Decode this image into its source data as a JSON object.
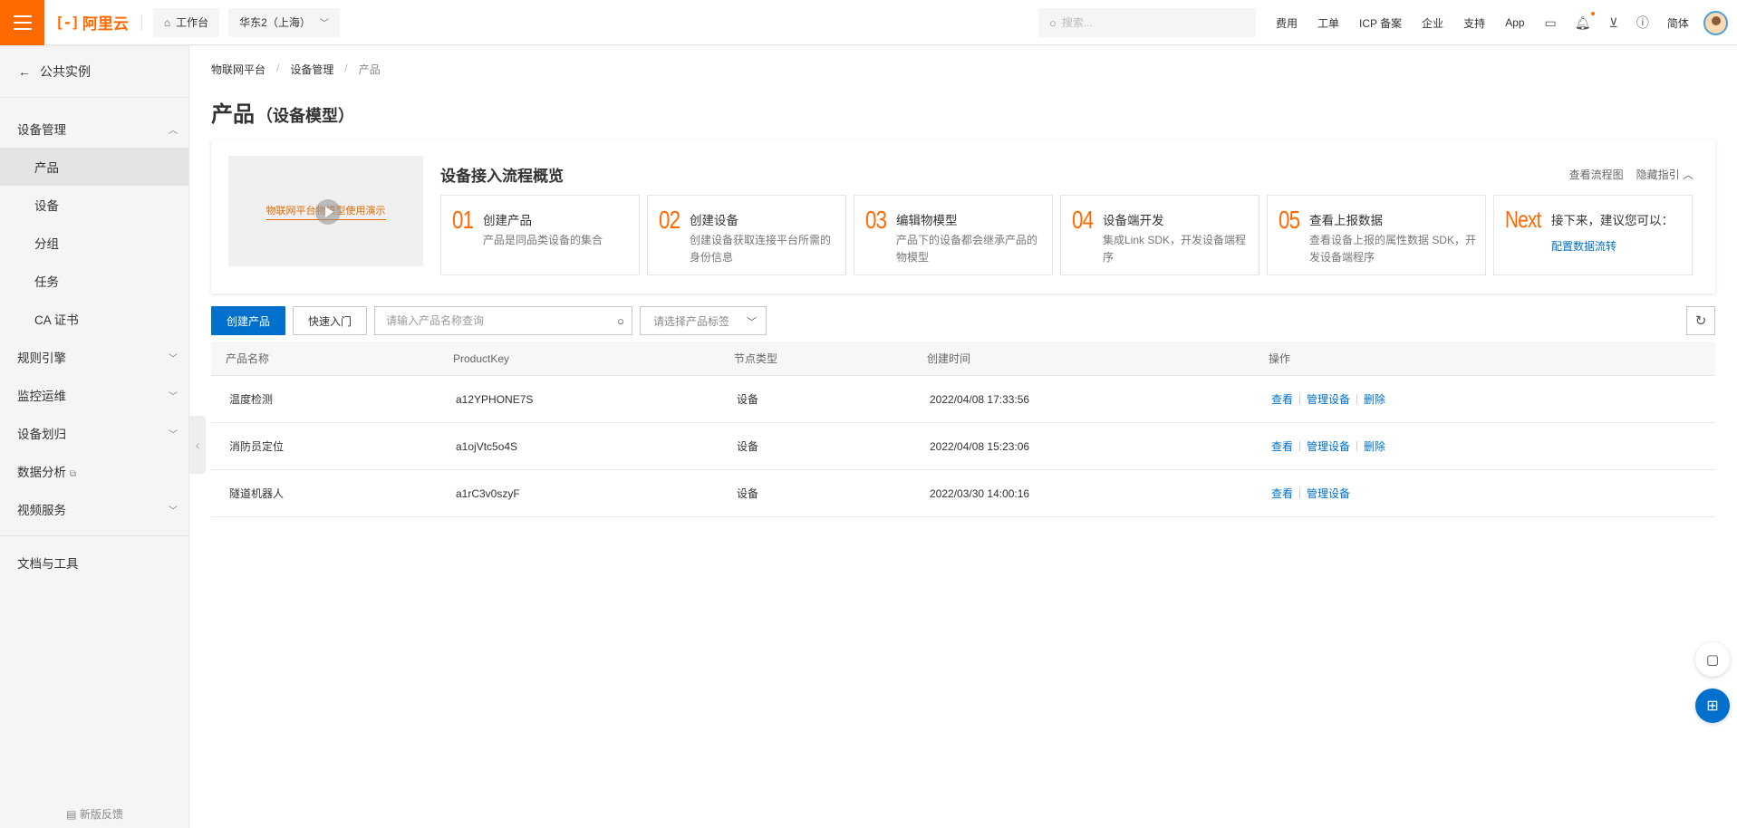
{
  "topbar": {
    "logo_mark": "[-]",
    "logo_text": "阿里云",
    "workbench": "工作台",
    "region": "华东2（上海）",
    "search_placeholder": "搜索...",
    "links": [
      "费用",
      "工单",
      "ICP 备案",
      "企业",
      "支持",
      "App"
    ],
    "lang": "简体",
    "accent_color": "#ff6a00"
  },
  "sidebar": {
    "back_label": "公共实例",
    "group_device_mgmt": "设备管理",
    "items": [
      "产品",
      "设备",
      "分组",
      "任务",
      "CA 证书"
    ],
    "active_item": "产品",
    "groups": [
      "规则引擎",
      "监控运维",
      "设备划归",
      "数据分析",
      "视频服务"
    ],
    "docs": "文档与工具",
    "feedback": "新版反馈"
  },
  "breadcrumb": [
    "物联网平台",
    "设备管理",
    "产品"
  ],
  "page": {
    "title": "产品",
    "subtitle": "（设备模型）"
  },
  "guide": {
    "video_caption": "物联网平台物模型使用演示",
    "title": "设备接入流程概览",
    "view_flow": "查看流程图",
    "hide_guide": "隐藏指引",
    "steps": [
      {
        "num": "01",
        "title": "创建产品",
        "desc": "产品是同品类设备的集合"
      },
      {
        "num": "02",
        "title": "创建设备",
        "desc": "创建设备获取连接平台所需的身份信息"
      },
      {
        "num": "03",
        "title": "编辑物模型",
        "desc": "产品下的设备都会继承产品的物模型"
      },
      {
        "num": "04",
        "title": "设备端开发",
        "desc": "集成Link SDK，开发设备端程序"
      },
      {
        "num": "05",
        "title": "查看上报数据",
        "desc": "查看设备上报的属性数据 SDK，开发设备端程序"
      },
      {
        "num": "Next",
        "title": "接下来，建议您可以：",
        "link": "配置数据流转"
      }
    ]
  },
  "toolbar": {
    "create_label": "创建产品",
    "quickstart_label": "快速入门",
    "search_placeholder": "请输入产品名称查询",
    "tag_placeholder": "请选择产品标签"
  },
  "table": {
    "columns": [
      "产品名称",
      "ProductKey",
      "节点类型",
      "创建时间",
      "操作"
    ],
    "rows": [
      {
        "name": "温度检测",
        "key": "a12YPHONE7S",
        "node": "设备",
        "time": "2022/04/08 17:33:56",
        "ops": [
          "查看",
          "管理设备",
          "删除"
        ]
      },
      {
        "name": "消防员定位",
        "key": "a1ojVtc5o4S",
        "node": "设备",
        "time": "2022/04/08 15:23:06",
        "ops": [
          "查看",
          "管理设备",
          "删除"
        ]
      },
      {
        "name": "隧道机器人",
        "key": "a1rC3v0szyF",
        "node": "设备",
        "time": "2022/03/30 14:00:16",
        "ops": [
          "查看",
          "管理设备"
        ]
      }
    ]
  },
  "colors": {
    "primary": "#0070cc",
    "brand": "#ff6a00"
  }
}
